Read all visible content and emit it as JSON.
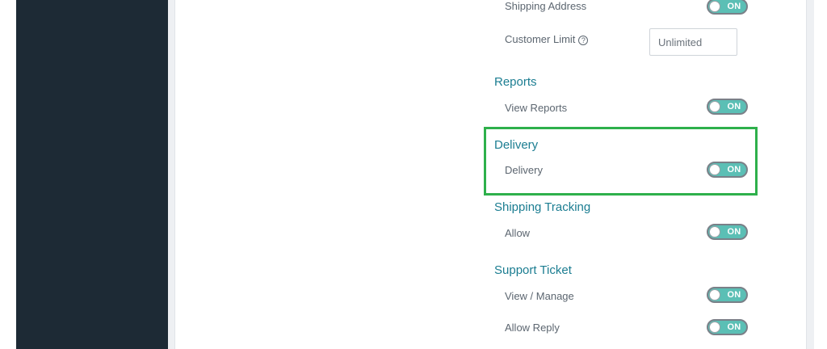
{
  "settings": {
    "shipping_address_label": "Shipping Address",
    "customer_limit_label": "Customer Limit",
    "customer_limit_help_icon": "question-circle-icon",
    "customer_limit_value": "Unlimited",
    "toggle_on_text": "ON",
    "reports": {
      "title": "Reports",
      "view_reports_label": "View Reports"
    },
    "delivery": {
      "title": "Delivery",
      "delivery_label": "Delivery"
    },
    "shipping_tracking": {
      "title": "Shipping Tracking",
      "allow_label": "Allow"
    },
    "support_ticket": {
      "title": "Support Ticket",
      "view_manage_label": "View / Manage",
      "allow_reply_label": "Allow Reply"
    }
  },
  "colors": {
    "sidebar": "#1d2a35",
    "section_title": "#1b7d91",
    "toggle_on": "#5bbfb5",
    "highlight": "#2eb04b"
  }
}
